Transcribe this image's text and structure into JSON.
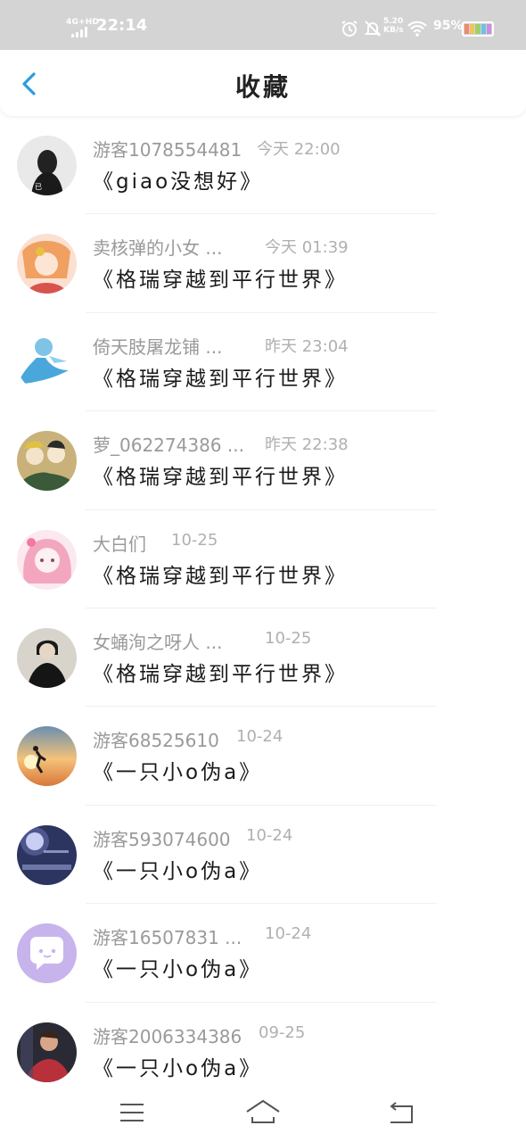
{
  "status_bar": {
    "network": "4G+HD",
    "time": "22:14",
    "speed_value": "5.20",
    "speed_unit": "KB/s",
    "battery": "95%",
    "icons": [
      "signal-icon",
      "alarm-icon",
      "silent-icon",
      "wifi-icon",
      "battery-icon"
    ]
  },
  "header": {
    "back_icon": "chevron-left-icon",
    "title": "收藏",
    "accent_color": "#2a9de0"
  },
  "items": [
    {
      "user": "游客1078554481",
      "date": "今天 22:00",
      "title": "《giao没想好》",
      "avatar": "dark-figure"
    },
    {
      "user": "卖核弹的小女 ...",
      "date": "今天 01:39",
      "title": "《格瑞穿越到平行世界》",
      "avatar": "anime-girl-orange"
    },
    {
      "user": "倚天肢屠龙铺 ...",
      "date": "昨天 23:04",
      "title": "《格瑞穿越到平行世界》",
      "avatar": "blue-creature"
    },
    {
      "user": "萝_062274386 ...",
      "date": "昨天 22:38",
      "title": "《格瑞穿越到平行世界》",
      "avatar": "anime-group"
    },
    {
      "user": "大白们",
      "date": "10-25",
      "title": "《格瑞穿越到平行世界》",
      "avatar": "anime-girl-pink"
    },
    {
      "user": "女蛹洵之呀人 ...",
      "date": "10-25",
      "title": "《格瑞穿越到平行世界》",
      "avatar": "man-black"
    },
    {
      "user": "游客68525610",
      "date": "10-24",
      "title": "《一只小o伪a》",
      "avatar": "sunset-runner"
    },
    {
      "user": "游客593074600",
      "date": "10-24",
      "title": "《一只小o伪a》",
      "avatar": "moon-night"
    },
    {
      "user": "游客16507831 ...",
      "date": "10-24",
      "title": "《一只小o伪a》",
      "avatar": "purple-chat"
    },
    {
      "user": "游客2006334386",
      "date": "09-25",
      "title": "《一只小o伪a》",
      "avatar": "person-red"
    }
  ],
  "nav": {
    "menu_icon": "menu-icon",
    "home_icon": "home-icon",
    "back_icon": "back-icon"
  }
}
